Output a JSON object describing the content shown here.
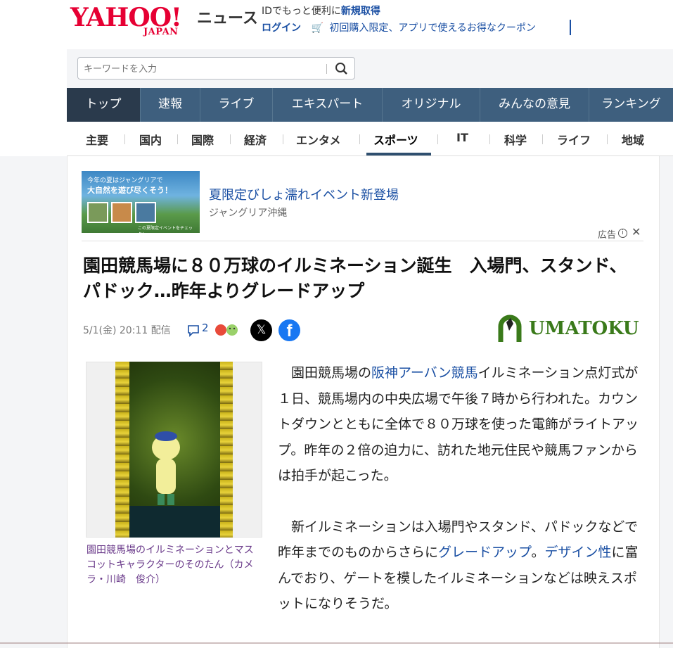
{
  "header": {
    "logo_text": "YAHOO!",
    "logo_sub": "JAPAN",
    "service": "ニュース",
    "id_prefix": "IDでもっと便利に",
    "id_link": "新規取得",
    "login": "ログイン",
    "coupon": "初回購入限定、アプリで使えるお得なクーポン"
  },
  "search": {
    "placeholder": "キーワードを入力"
  },
  "main_nav": [
    "トップ",
    "速報",
    "ライブ",
    "エキスパート",
    "オリジナル",
    "みんなの意見",
    "ランキング"
  ],
  "sub_nav": [
    "主要",
    "国内",
    "国際",
    "経済",
    "エンタメ",
    "スポーツ",
    "IT",
    "科学",
    "ライフ",
    "地域"
  ],
  "ad": {
    "image_line1": "今年の夏はジャングリアで",
    "image_line2": "大自然を遊び尽くそう！",
    "image_footer": "この夏限定イベントをチェック！",
    "title": "夏限定びしょ濡れイベント新登場",
    "sponsor": "ジャングリア沖縄",
    "label": "広告"
  },
  "article": {
    "title": "園田競馬場に８０万球のイルミネーション誕生　入場門、スタンド、パドック…昨年よりグレードアップ",
    "date": "5/1(金) 20:11 配信",
    "comment_count": "2",
    "source": "UMATOKU",
    "caption": "園田競馬場のイルミネーションとマスコットキャラクターのそのたん（カメラ・川崎　俊介）",
    "p1_a": "園田競馬場の",
    "p1_link": "阪神アーバン競馬",
    "p1_b": "イルミネーション点灯式が１日、競馬場内の中央広場で午後７時から行われた。カウントダウンとともに全体で８０万球を使った電飾がライトアップ。昨年の２倍の迫力に、訪れた地元住民や競馬ファンからは拍手が起こった。",
    "p2_a": "新イルミネーションは入場門やスタンド、パドックなどで昨年までのものからさらに",
    "p2_link1": "グレードアップ",
    "p2_b": "。",
    "p2_link2": "デザイン性",
    "p2_c": "に富んでおり、ゲートを模したイルミネーションなどは映えスポットになりそうだ。"
  },
  "colors": {
    "nav_bg": "#3e5f7e",
    "nav_active": "#2a3a4c",
    "link": "#1a4fa3",
    "brand": "#e60033"
  }
}
